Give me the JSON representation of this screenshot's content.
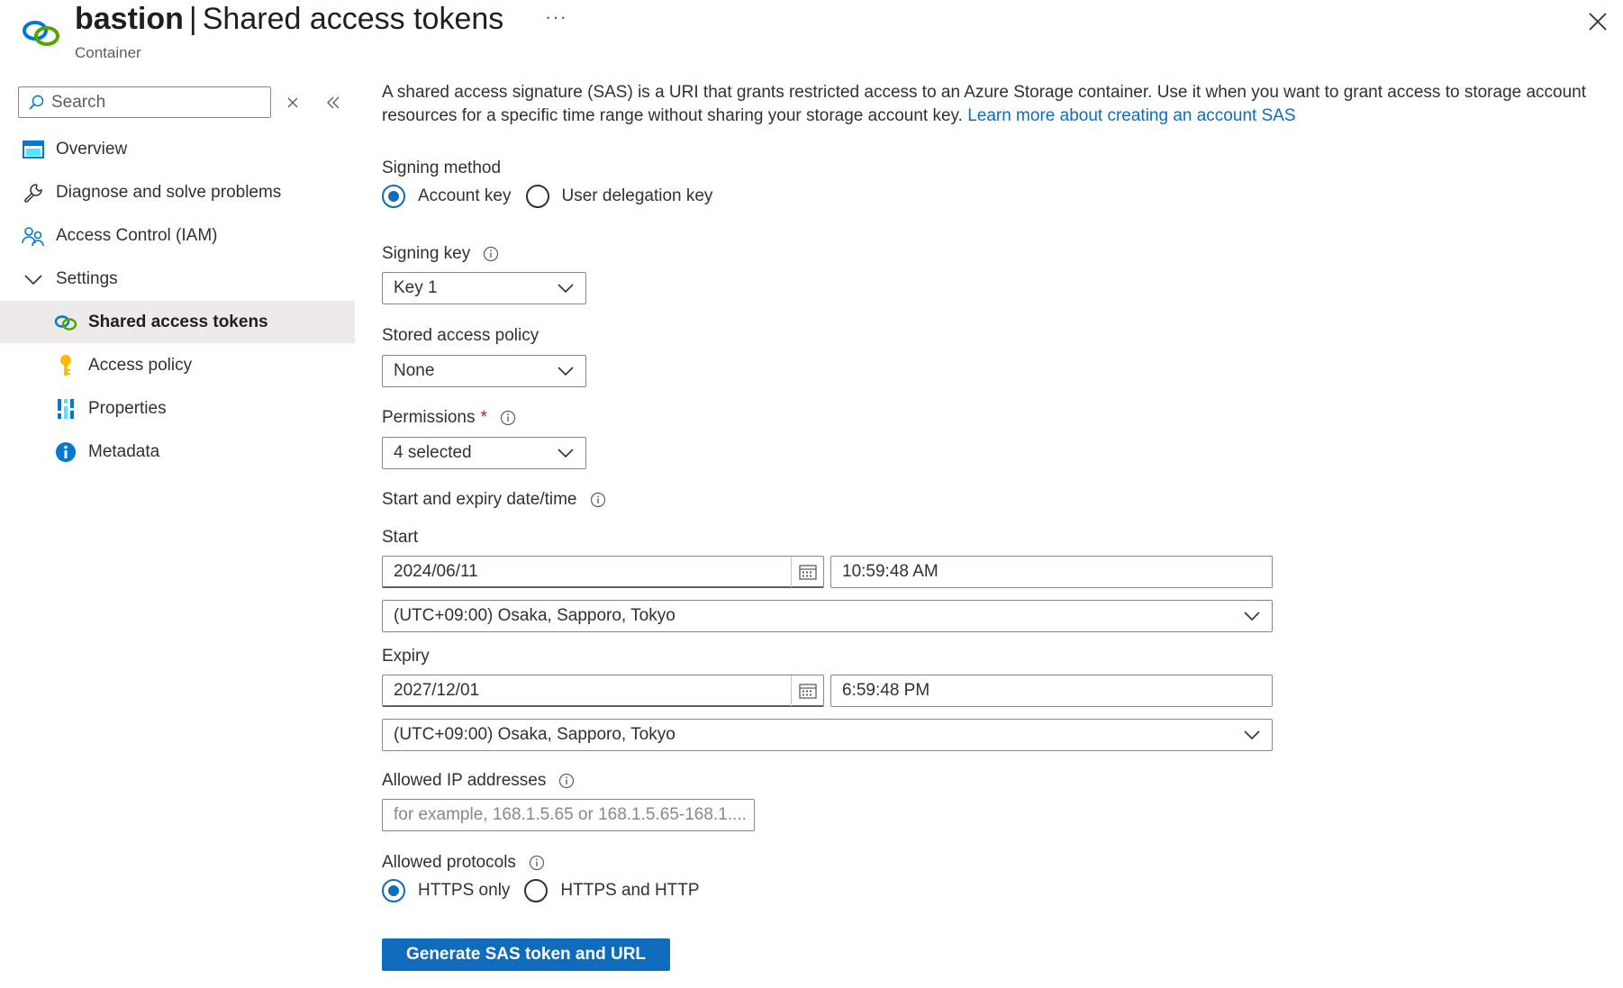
{
  "header": {
    "resource_name": "bastion",
    "separator": "|",
    "page_title": "Shared access tokens",
    "resource_type": "Container",
    "more_label": "···"
  },
  "sidebar": {
    "search": {
      "placeholder": "Search"
    },
    "items": [
      {
        "label": "Overview",
        "icon": "overview-icon"
      },
      {
        "label": "Diagnose and solve problems",
        "icon": "wrench-icon"
      },
      {
        "label": "Access Control (IAM)",
        "icon": "people-icon"
      },
      {
        "label": "Settings",
        "icon": "chevron-down-icon"
      },
      {
        "label": "Shared access tokens",
        "icon": "link-icon",
        "active": true
      },
      {
        "label": "Access policy",
        "icon": "key-icon"
      },
      {
        "label": "Properties",
        "icon": "properties-icon"
      },
      {
        "label": "Metadata",
        "icon": "info-icon"
      }
    ]
  },
  "main": {
    "description": "A shared access signature (SAS) is a URI that grants restricted access to an Azure Storage container. Use it when you want to grant access to storage account resources for a specific time range without sharing your storage account key.",
    "learn_more": "Learn more about creating an account SAS",
    "signing_method": {
      "label": "Signing method",
      "options": [
        "Account key",
        "User delegation key"
      ],
      "selected": "Account key"
    },
    "signing_key": {
      "label": "Signing key",
      "value": "Key 1"
    },
    "stored_access_policy": {
      "label": "Stored access policy",
      "value": "None"
    },
    "permissions": {
      "label": "Permissions",
      "required_mark": "*",
      "value": "4 selected"
    },
    "datetime_section": {
      "label": "Start and expiry date/time"
    },
    "start": {
      "label": "Start",
      "date": "2024/06/11",
      "time": "10:59:48 AM",
      "timezone": "(UTC+09:00) Osaka, Sapporo, Tokyo"
    },
    "expiry": {
      "label": "Expiry",
      "date": "2027/12/01",
      "time": "6:59:48 PM",
      "timezone": "(UTC+09:00) Osaka, Sapporo, Tokyo"
    },
    "allowed_ip": {
      "label": "Allowed IP addresses",
      "placeholder": "for example, 168.1.5.65 or 168.1.5.65-168.1...."
    },
    "allowed_protocols": {
      "label": "Allowed protocols",
      "options": [
        "HTTPS only",
        "HTTPS and HTTP"
      ],
      "selected": "HTTPS only"
    },
    "generate_button": "Generate SAS token and URL"
  },
  "colors": {
    "accent": "#0f6cbd",
    "active_nav_bg": "#edebe9",
    "required": "#a4262c"
  }
}
